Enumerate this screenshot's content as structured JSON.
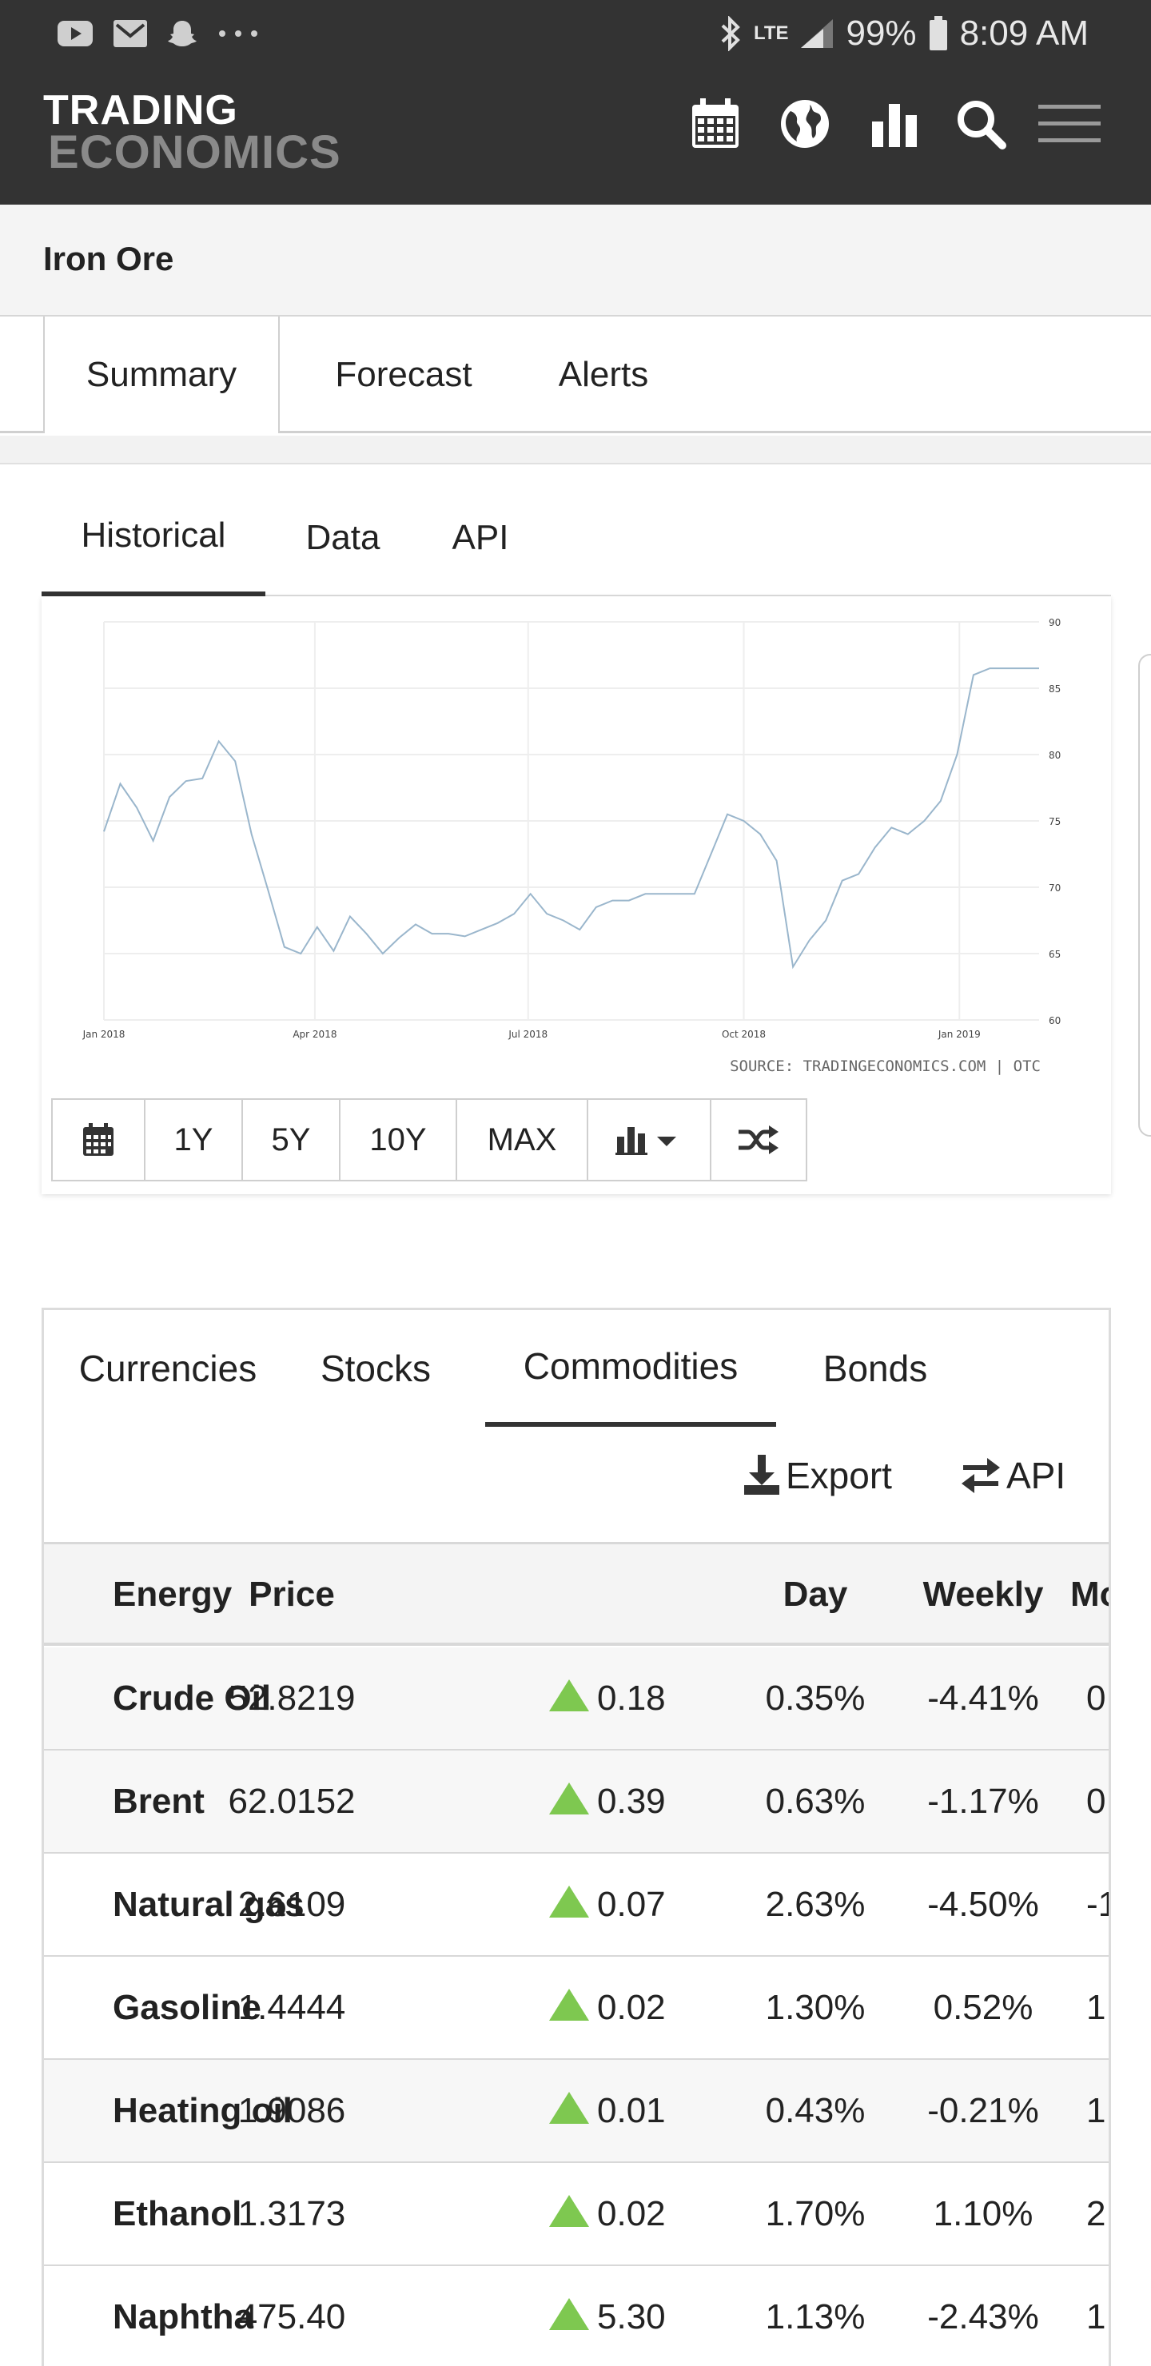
{
  "status_bar": {
    "left_icons": [
      "youtube-icon",
      "mail-icon",
      "snapchat-icon",
      "more-dots-icon"
    ],
    "network": "LTE",
    "battery": "99%",
    "time": "8:09 AM"
  },
  "header": {
    "logo_line1": "TRADING",
    "logo_line2": "ECONOMICS",
    "icons": [
      "calendar-icon",
      "globe-icon",
      "bar-chart-icon",
      "search-icon",
      "menu-icon"
    ]
  },
  "page": {
    "title": "Iron Ore"
  },
  "top_tabs": [
    "Summary",
    "Forecast",
    "Alerts"
  ],
  "chart_tabs": [
    "Historical",
    "Data",
    "API"
  ],
  "chart_data": {
    "type": "line",
    "title": "",
    "xlabel": "",
    "ylabel": "",
    "x_ticks": [
      "Jan 2018",
      "Apr 2018",
      "Jul 2018",
      "Oct 2018",
      "Jan 2019"
    ],
    "y_ticks": [
      60,
      65,
      70,
      75,
      80,
      85,
      90
    ],
    "ylim": [
      60,
      90
    ],
    "x": [
      "2018-01-01",
      "2018-01-08",
      "2018-01-15",
      "2018-01-22",
      "2018-01-29",
      "2018-02-05",
      "2018-02-12",
      "2018-02-19",
      "2018-02-26",
      "2018-03-05",
      "2018-03-12",
      "2018-03-19",
      "2018-03-26",
      "2018-04-02",
      "2018-04-09",
      "2018-04-16",
      "2018-04-23",
      "2018-04-30",
      "2018-05-07",
      "2018-05-14",
      "2018-05-21",
      "2018-05-28",
      "2018-06-04",
      "2018-06-11",
      "2018-06-18",
      "2018-06-25",
      "2018-07-02",
      "2018-07-09",
      "2018-07-16",
      "2018-07-23",
      "2018-07-30",
      "2018-08-06",
      "2018-08-13",
      "2018-08-20",
      "2018-08-27",
      "2018-09-03",
      "2018-09-10",
      "2018-09-17",
      "2018-09-24",
      "2018-10-01",
      "2018-10-08",
      "2018-10-15",
      "2018-10-22",
      "2018-10-29",
      "2018-11-05",
      "2018-11-12",
      "2018-11-19",
      "2018-11-26",
      "2018-12-03",
      "2018-12-10",
      "2018-12-17",
      "2018-12-24",
      "2018-12-31",
      "2019-01-07",
      "2019-01-14",
      "2019-01-21",
      "2019-01-28",
      "2019-02-04"
    ],
    "values": [
      74.2,
      77.8,
      76.0,
      73.5,
      76.8,
      78.0,
      78.2,
      81.0,
      79.5,
      74.0,
      69.8,
      65.5,
      65.0,
      67.0,
      65.2,
      67.8,
      66.5,
      65.0,
      66.2,
      67.2,
      66.5,
      66.5,
      66.3,
      66.8,
      67.3,
      68.0,
      69.5,
      68.0,
      67.5,
      66.8,
      68.5,
      69.0,
      69.0,
      69.5,
      69.5,
      69.5,
      69.5,
      72.5,
      75.5,
      75.0,
      74.0,
      72.0,
      64.0,
      66.0,
      67.5,
      70.5,
      71.0,
      73.0,
      74.5,
      74.0,
      75.0,
      76.5,
      80.0,
      86.0,
      86.5,
      86.5,
      86.5,
      86.5
    ],
    "series_color": "#9ab6cc",
    "source": "SOURCE: TRADINGECONOMICS.COM | OTC",
    "grid": true
  },
  "chart_tools": {
    "icons": [
      "calendar-icon",
      "bar-chart-dropdown-icon",
      "shuffle-icon"
    ],
    "ranges": [
      "1Y",
      "5Y",
      "10Y",
      "MAX"
    ]
  },
  "market_tabs": [
    "Currencies",
    "Stocks",
    "Commodities",
    "Bonds"
  ],
  "actions": {
    "export": "Export",
    "api": "API"
  },
  "table": {
    "headers": [
      "Energy",
      "Price",
      "Day",
      "Weekly",
      "Mo"
    ],
    "rows": [
      {
        "name": "Crude Oil",
        "price": "52.8219",
        "change": "0.18",
        "day": "0.35%",
        "weekly": "-4.41%",
        "monthly": "0"
      },
      {
        "name": "Brent",
        "price": "62.0152",
        "change": "0.39",
        "day": "0.63%",
        "weekly": "-1.17%",
        "monthly": "0"
      },
      {
        "name": "Natural gas",
        "price": "2.6109",
        "change": "0.07",
        "day": "2.63%",
        "weekly": "-4.50%",
        "monthly": "-1"
      },
      {
        "name": "Gasoline",
        "price": "1.4444",
        "change": "0.02",
        "day": "1.30%",
        "weekly": "0.52%",
        "monthly": "1"
      },
      {
        "name": "Heating oil",
        "price": "1.9086",
        "change": "0.01",
        "day": "0.43%",
        "weekly": "-0.21%",
        "monthly": "1"
      },
      {
        "name": "Ethanol",
        "price": "1.3173",
        "change": "0.02",
        "day": "1.70%",
        "weekly": "1.10%",
        "monthly": "2"
      },
      {
        "name": "Naphtha",
        "price": "475.40",
        "change": "5.30",
        "day": "1.13%",
        "weekly": "-2.43%",
        "monthly": "1"
      }
    ],
    "up_color": "#7ec850"
  }
}
